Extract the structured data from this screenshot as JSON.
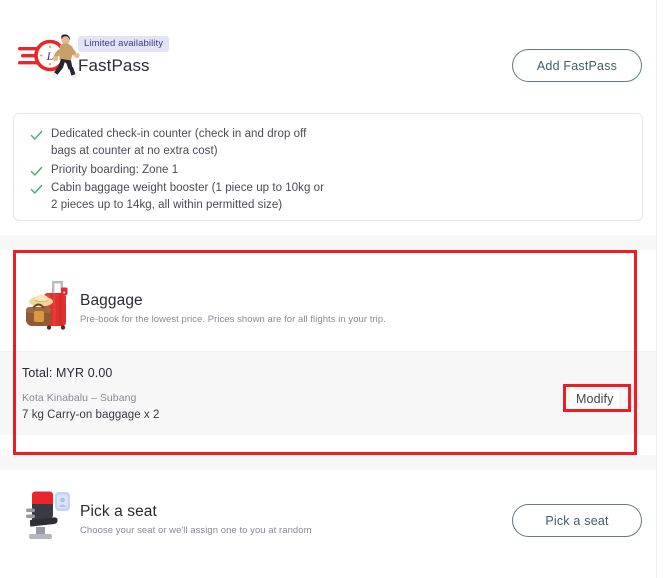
{
  "fastpass": {
    "icon_name": "fastpass-running-clock-icon",
    "badge": "Limited availability",
    "title": "FastPass",
    "add_button": "Add FastPass",
    "benefits": [
      "Dedicated check-in counter (check in and drop off",
      "bags at counter at no extra cost)",
      "Priority boarding: Zone 1",
      "Cabin baggage weight booster (1 piece up to 10kg or",
      "2 pieces up to 14kg, all within permitted size)"
    ],
    "benefit_items": [
      "Dedicated check-in counter (check in and drop off bags at counter at no extra cost)",
      "Priority boarding: Zone 1",
      "Cabin baggage weight booster (1 piece up to 10kg or 2 pieces up to 14kg, all within permitted size)"
    ]
  },
  "baggage": {
    "icon_name": "suitcase-duffel-bag-icon",
    "title": "Baggage",
    "subtitle": "Pre-book for the lowest price. Prices shown are for all flights in your trip.",
    "total_label": "Total:  MYR 0.00",
    "route": "Kota Kinabalu – Subang",
    "detail": "7 kg Carry-on baggage x 2",
    "modify_label": "Modify"
  },
  "seat": {
    "icon_name": "airplane-seat-icon",
    "title": "Pick a seat",
    "subtitle": "Choose your seat or we'll assign one to you at random",
    "button_label": "Pick a seat"
  },
  "colors": {
    "accent_red": "#ee1c25",
    "badge_bg": "#e4e2f5",
    "badge_text": "#3c3b8f",
    "button_border": "#5d7d7d",
    "button_text": "#3f5f63",
    "check_green": "#4caf6d",
    "panel_grey": "#f7f7f7"
  }
}
